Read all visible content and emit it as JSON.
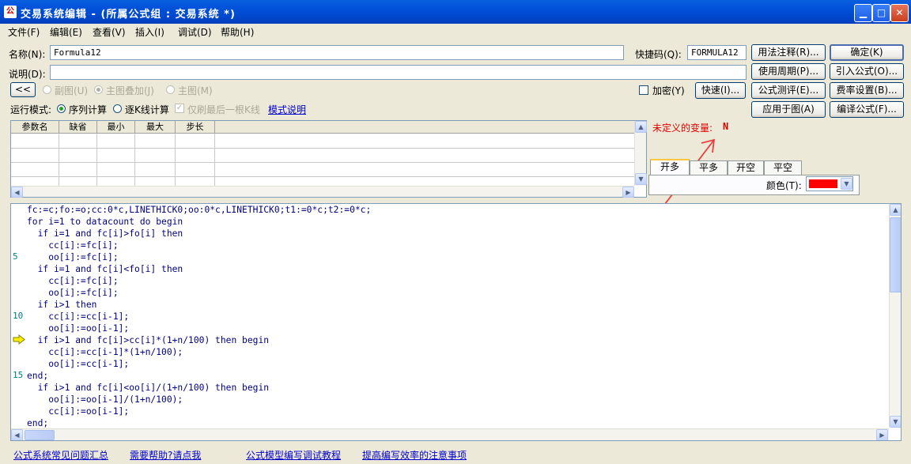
{
  "window": {
    "app_icon": "公",
    "title": "交易系统编辑 - (所属公式组 : 交易系统 *)",
    "minimize": "▁",
    "maximize": "□",
    "close": "✕"
  },
  "menu": [
    "文件(F)",
    "编辑(E)",
    "查看(V)",
    "插入(I)",
    "调试(D)",
    "帮助(H)"
  ],
  "form": {
    "name_label": "名称(N):",
    "name_value": "Formula12",
    "hotkey_label": "快捷码(Q):",
    "hotkey_value": "FORMULA12",
    "desc_label": "说明(D):",
    "desc_value": "",
    "collapse_btn": "<<",
    "sub_chart": "副图(U)",
    "main_overlay": "主图叠加(J)",
    "main_chart": "主图(M)",
    "encrypt": "加密(Y)",
    "quick_btn": "快速(I)...",
    "run_mode_label": "运行模式:",
    "seq_calc": "序列计算",
    "kline_calc": "逐K线计算",
    "last_kline": "仅刷最后一根K线",
    "mode_desc_link": "模式说明"
  },
  "buttons": {
    "usage_notes": "用法注释(R)...",
    "ok": "确定(K)",
    "period": "使用周期(P)...",
    "import": "引入公式(O)...",
    "test": "公式测评(E)...",
    "fee": "费率设置(B)...",
    "apply": "应用于图(A)",
    "compile": "编译公式(F)..."
  },
  "param_table": {
    "headers": [
      "参数名",
      "缺省",
      "最小",
      "最大",
      "步长"
    ]
  },
  "undefined_var": {
    "label": "未定义的变量:",
    "value": "N"
  },
  "tabs": [
    "开多",
    "平多",
    "开空",
    "平空"
  ],
  "color_label": "颜色(T):",
  "colors": {
    "selected": "#FF0000"
  },
  "code_lines": [
    "fc:=c;fo:=o;cc:0*c,LINETHICK0;oo:0*c,LINETHICK0;t1:=0*c;t2:=0*c;",
    "for i=1 to datacount do begin",
    "  if i=1 and fc[i]>fo[i] then",
    "    cc[i]:=fc[i];",
    "    oo[i]:=fc[i];",
    "  if i=1 and fc[i]<fo[i] then",
    "    cc[i]:=fc[i];",
    "    oo[i]:=fc[i];",
    "  if i>1 then",
    "    cc[i]:=cc[i-1];",
    "    oo[i]:=oo[i-1];",
    "  if i>1 and fc[i]>cc[i]*(1+n/100) then begin",
    "    cc[i]:=cc[i-1]*(1+n/100);",
    "    oo[i]:=cc[i-1];",
    "end;",
    "  if i>1 and fc[i]<oo[i]/(1+n/100) then begin",
    "    oo[i]:=oo[i-1]/(1+n/100);",
    "    cc[i]:=oo[i-1];",
    "end;"
  ],
  "line_numbers": [
    "5",
    "10",
    "15"
  ],
  "footer_links": [
    "公式系统常见问题汇总",
    "需要帮助?请点我",
    "公式模型编写调试教程",
    "提高编写效率的注意事项"
  ]
}
